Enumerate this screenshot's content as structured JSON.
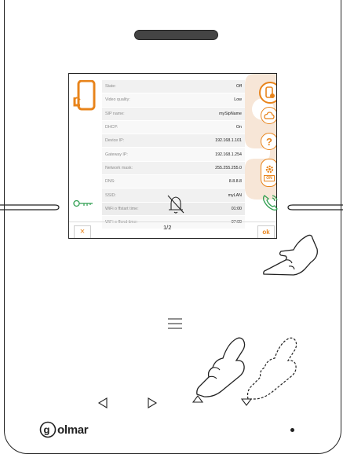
{
  "settings": {
    "rows": [
      {
        "label": "State:",
        "value": "Off"
      },
      {
        "label": "Video quality:",
        "value": "Low"
      },
      {
        "label": "SIP name:",
        "value": "mySipName"
      },
      {
        "label": "DHCP:",
        "value": "On"
      },
      {
        "label": "Device IP:",
        "value": "192.168.1.101"
      },
      {
        "label": "Gateway IP:",
        "value": "192.168.1.254"
      },
      {
        "label": "Network mask:",
        "value": "255.255.255.0"
      },
      {
        "label": "DNS:",
        "value": "8.8.8.8"
      },
      {
        "label": "SSID:",
        "value": "myLAN"
      },
      {
        "label": "WiFi o ffstart time:",
        "value": "01:00"
      },
      {
        "label": "WiFi o ffend time:",
        "value": "07:00"
      }
    ]
  },
  "screen": {
    "close_label": "×",
    "ok_label": "ok",
    "page_indicator": "1/2",
    "on_label": "ON"
  },
  "brand": {
    "logo_text": "olmar"
  },
  "colors": {
    "accent": "#e8841b",
    "green": "#2e9e4f",
    "watermark": "#f7e6d7"
  },
  "icons": {
    "screen": [
      "phone-settings-icon",
      "phone-gear-icon",
      "cloud-icon",
      "phone-question-icon",
      "gear-on-icon"
    ],
    "device": [
      "key-icon",
      "bell-mute-icon",
      "phone-call-icon",
      "menu-icon",
      "left-arrow-icon",
      "right-arrow-icon",
      "hand-pointer-icon"
    ]
  }
}
